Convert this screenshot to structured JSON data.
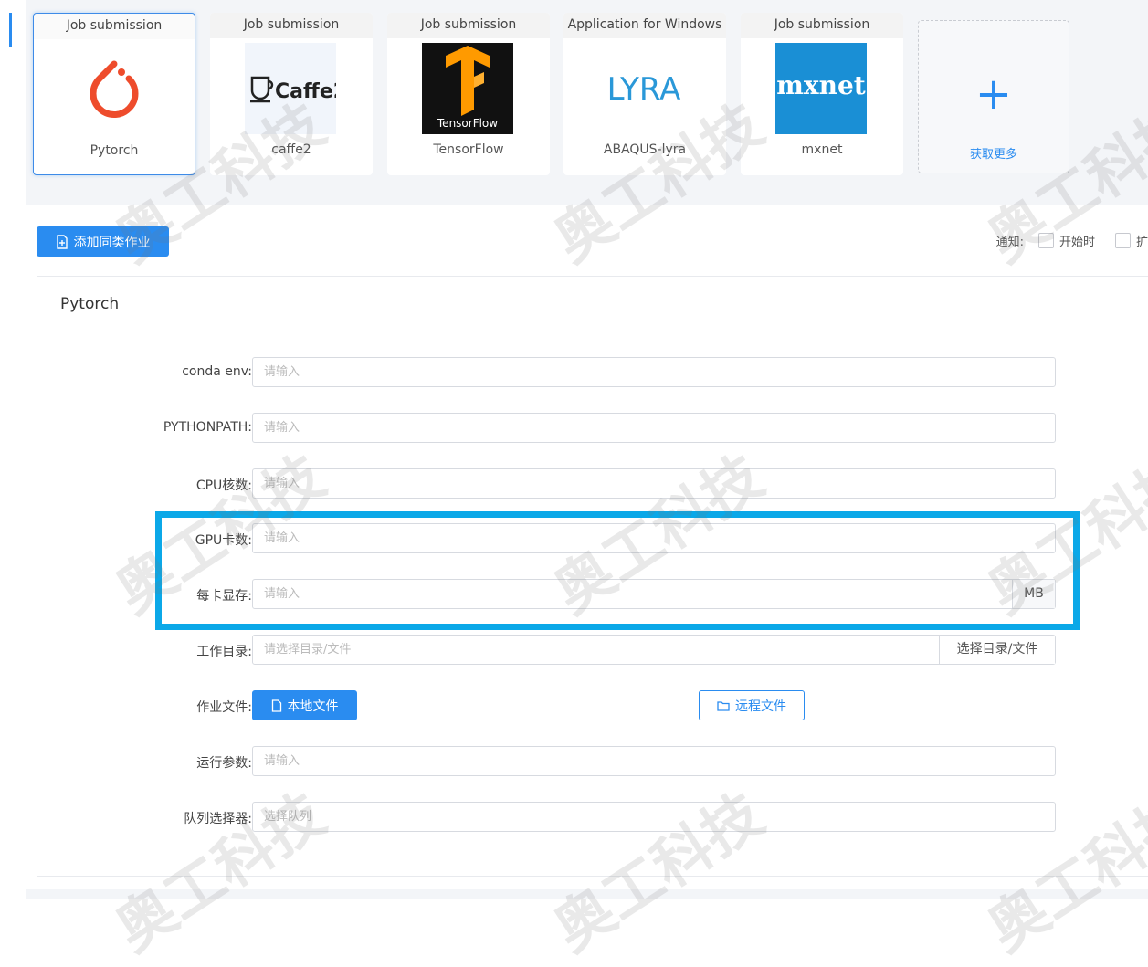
{
  "cards": [
    {
      "header": "Job submission",
      "name": "Pytorch"
    },
    {
      "header": "Job submission",
      "name": "caffe2",
      "logo_text": "Caffe2"
    },
    {
      "header": "Job submission",
      "name": "TensorFlow",
      "logo_text": "TensorFlow"
    },
    {
      "header": "Application for Windows",
      "name": "ABAQUS-lyra",
      "logo_text": "LYRA"
    },
    {
      "header": "Job submission",
      "name": "mxnet",
      "logo_text": "mxnet"
    }
  ],
  "add_card": {
    "label": "获取更多"
  },
  "toolbar": {
    "add_button": "添加同类作业",
    "notify_label": "通知:",
    "notify_option_start": "开始时",
    "notify_option_cut": "扩"
  },
  "form": {
    "title": "Pytorch",
    "fields": [
      {
        "label": "conda env:",
        "placeholder": "请输入"
      },
      {
        "label": "PYTHONPATH:",
        "placeholder": "请输入"
      },
      {
        "label": "CPU核数:",
        "placeholder": "请输入"
      },
      {
        "label": "GPU卡数:",
        "placeholder": "请输入"
      },
      {
        "label": "每卡显存:",
        "placeholder": "请输入",
        "suffix": "MB"
      },
      {
        "label": "工作目录:",
        "placeholder": "请选择目录/文件",
        "suffix": "选择目录/文件"
      },
      {
        "label": "作业文件:",
        "local_button": "本地文件",
        "remote_button": "远程文件"
      },
      {
        "label": "运行参数:",
        "placeholder": "请输入"
      },
      {
        "label": "队列选择器:",
        "placeholder": "选择队列"
      }
    ]
  },
  "watermark": "奥工科技",
  "colors": {
    "accent": "#2a8cf0",
    "highlight": "#0ba8e8",
    "pytorch": "#ee4c2c",
    "tensorflow": "#ff9a00",
    "mxnet": "#1a8fd5"
  }
}
